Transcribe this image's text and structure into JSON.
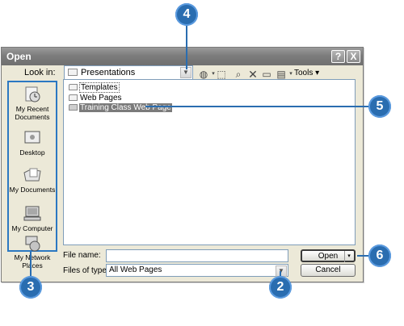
{
  "dialog": {
    "title": "Open",
    "title_buttons": {
      "help": "?",
      "close": "X"
    },
    "look_in_label": "Look in:",
    "look_in_value": "Presentations",
    "tools_label": "Tools"
  },
  "places": [
    {
      "label": "My Recent Documents"
    },
    {
      "label": "Desktop"
    },
    {
      "label": "My Documents"
    },
    {
      "label": "My Computer"
    },
    {
      "label": "My Network Places"
    }
  ],
  "files": [
    {
      "name": "Templates"
    },
    {
      "name": "Web Pages"
    },
    {
      "name": "Training Class Web Page"
    }
  ],
  "file_name": {
    "label": "File name:",
    "value": ""
  },
  "files_of_type": {
    "label": "Files of type:",
    "value": "All Web Pages"
  },
  "buttons": {
    "open": "Open",
    "cancel": "Cancel"
  },
  "callouts": [
    "4",
    "5",
    "3",
    "2",
    "6"
  ],
  "colors": {
    "callout": "#2a6db0",
    "selection": "#7b7b7b"
  }
}
